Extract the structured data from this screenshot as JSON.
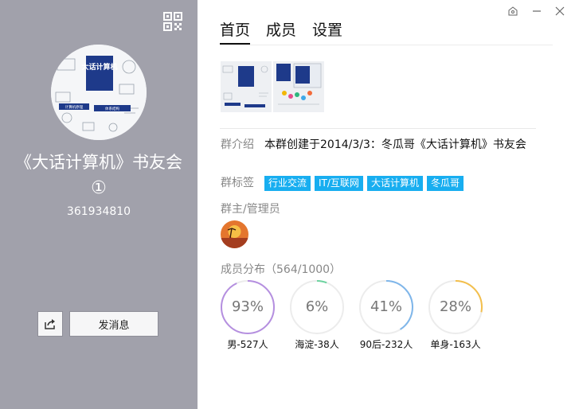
{
  "group": {
    "name": "《大话计算机》书友会",
    "circle_mark": "①",
    "id": "361934810",
    "avatar_text": "大话计算机",
    "avatar_strip_1": "计算机原理",
    "avatar_strip_2": "体系结构"
  },
  "actions": {
    "send_message": "发消息"
  },
  "tabs": [
    {
      "label": "首页",
      "active": true
    },
    {
      "label": "成员",
      "active": false
    },
    {
      "label": "设置",
      "active": false
    }
  ],
  "info": {
    "intro_label": "群介绍",
    "intro_text": "本群创建于2014/3/3：冬瓜哥《大话计算机》书友会",
    "tags_label": "群标签",
    "tags": [
      "行业交流",
      "IT/互联网",
      "大话计算机",
      "冬瓜哥"
    ],
    "admins_label": "群主/管理员",
    "distribution_label": "成员分布（564/1000）"
  },
  "stats": [
    {
      "percent_text": "93%",
      "value": 0.93,
      "label": "男-527人",
      "color": "#b58fe0"
    },
    {
      "percent_text": "6%",
      "value": 0.06,
      "label": "海淀-38人",
      "color": "#6dd3a0"
    },
    {
      "percent_text": "41%",
      "value": 0.41,
      "label": "90后-232人",
      "color": "#7fb6ea"
    },
    {
      "percent_text": "28%",
      "value": 0.28,
      "label": "单身-163人",
      "color": "#f3bf4c"
    }
  ],
  "icons": {
    "qr": "qr-code-icon",
    "share": "share-icon",
    "skin": "skin-icon",
    "minimize": "minimize-icon",
    "close": "close-icon"
  },
  "colors": {
    "left_panel": "#a1a1ab",
    "tag": "#18aef0"
  }
}
